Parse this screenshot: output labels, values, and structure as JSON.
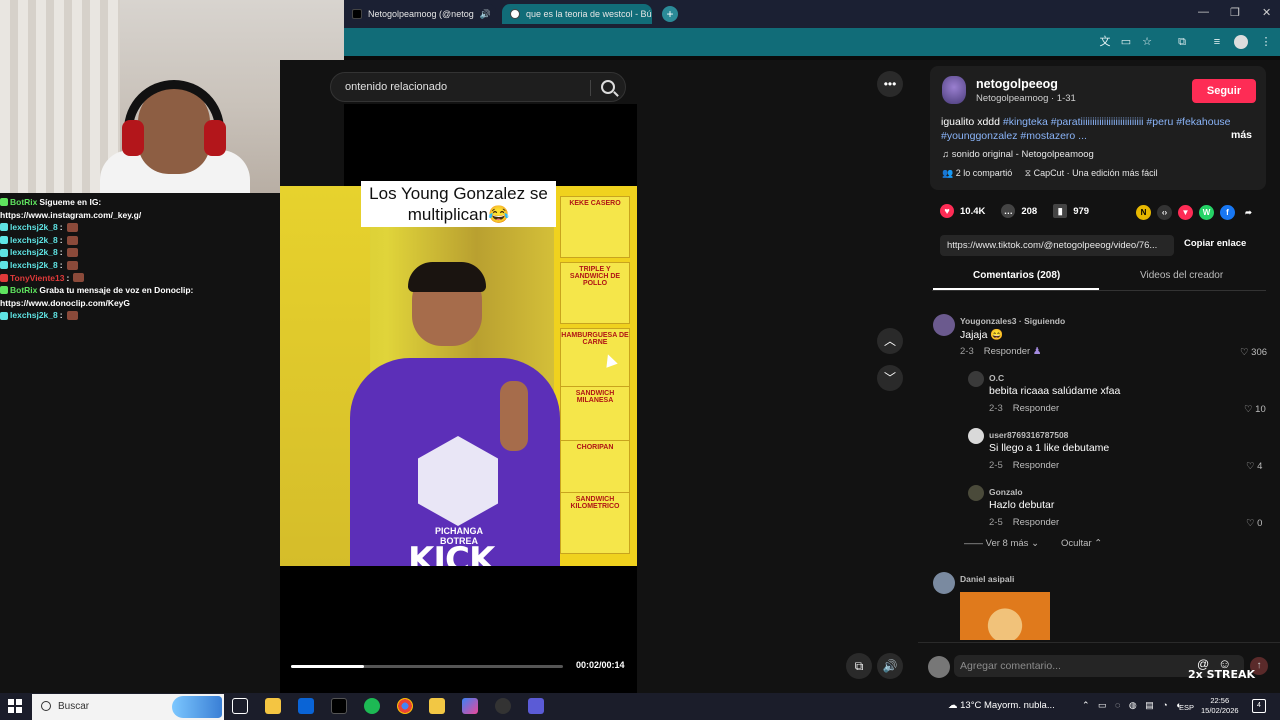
{
  "chat": [
    {
      "user": "BotRix",
      "color": "#5fe35f",
      "msg": "Sígueme en IG:",
      "cont": "https://www.instagram.com/_key.g/"
    },
    {
      "user": "lexchsj2k_8",
      "color": "#5fe3e3",
      "msg": ":",
      "emote": true
    },
    {
      "user": "lexchsj2k_8",
      "color": "#5fe3e3",
      "msg": ":",
      "emote": true
    },
    {
      "user": "lexchsj2k_8",
      "color": "#5fe3e3",
      "msg": ":",
      "emote": true
    },
    {
      "user": "lexchsj2k_8",
      "color": "#5fe3e3",
      "msg": ":",
      "emote": true
    },
    {
      "user": "TonyViente13",
      "color": "#e03a3a",
      "msg": ":",
      "emote": true
    },
    {
      "user": "BotRix",
      "color": "#5fe35f",
      "msg": "Graba tu mensaje de voz en Donoclip:",
      "cont": "https://www.donoclip.com/KeyG"
    },
    {
      "user": "lexchsj2k_8",
      "color": "#5fe3e3",
      "msg": ":",
      "emote": true
    }
  ],
  "browser": {
    "tabs": [
      {
        "title": "Netogolpeamoog (@netog",
        "active": false
      },
      {
        "title": "que es la teoria de westcol - Bú",
        "active": true
      }
    ]
  },
  "player": {
    "search_placeholder": "ontenido relacionado",
    "caption": "Los Young Gonzalez se multiplican😂",
    "watermark": "KICK",
    "timecode": "00:02/00:14",
    "progress": 0.27,
    "menu_items": [
      "KEKE CASERO",
      "TRIPLE Y SANDWICH DE POLLO",
      "HAMBURGUESA DE CARNE",
      "SANDWICH MILANESA",
      "CHORIPAN",
      "SANDWICH KILOMETRICO"
    ],
    "shirt_text": "PICHANGA BOTREA"
  },
  "author": {
    "username": "netogolpeeog",
    "subtitle": "Netogolpeamoog · 1-31",
    "follow_label": "Seguir",
    "desc_plain": "igualito xddd ",
    "desc_tags": "#kingteka #paratiiiiiiiiiiiiiiiiiiiiiiiiiii #peru #fekahouse #younggonzalez #mostazero ...",
    "more_label": "más",
    "sound": "sonido original - Netogolpeamoog",
    "shared": "2 lo compartió",
    "capcut": "CapCut · Una edición más fácil"
  },
  "stats": {
    "likes": "10.4K",
    "comments": "208",
    "saves": "979"
  },
  "link": {
    "url": "https://www.tiktok.com/@netogolpeeog/video/76...",
    "copy_label": "Copiar enlace"
  },
  "tabs": {
    "comments": "Comentarios (208)",
    "videos": "Videos del creador"
  },
  "comments": [
    {
      "user": "Yougonzales3 · Siguiendo",
      "text": "Jajaja 😄",
      "date": "2-3",
      "reply": "Responder",
      "likes": "306"
    },
    {
      "user": "O.C",
      "text": "bebita ricaaa salúdame xfaa",
      "date": "2-3",
      "reply": "Responder",
      "likes": "10"
    },
    {
      "user": "user8769316787508",
      "text": "Si llego a 1 like debutame",
      "date": "2-5",
      "reply": "Responder",
      "likes": "4"
    },
    {
      "user": "Gonzalo",
      "text": "Hazlo debutar",
      "date": "2-5",
      "reply": "Responder",
      "likes": "0"
    },
    {
      "user": "Daniel asipali",
      "text": "",
      "date": "",
      "reply": "",
      "likes": ""
    }
  ],
  "replies_controls": {
    "more": "Ver 8 más",
    "hide": "Ocultar"
  },
  "comment_box": {
    "placeholder": "Agregar comentario...",
    "streak": "2x STREAK"
  },
  "taskbar": {
    "search": "Buscar",
    "weather": "13°C  Mayorm. nubla...",
    "lang": "ESP",
    "time": "22:56",
    "date": "15/02/2026",
    "notifications": "4"
  }
}
